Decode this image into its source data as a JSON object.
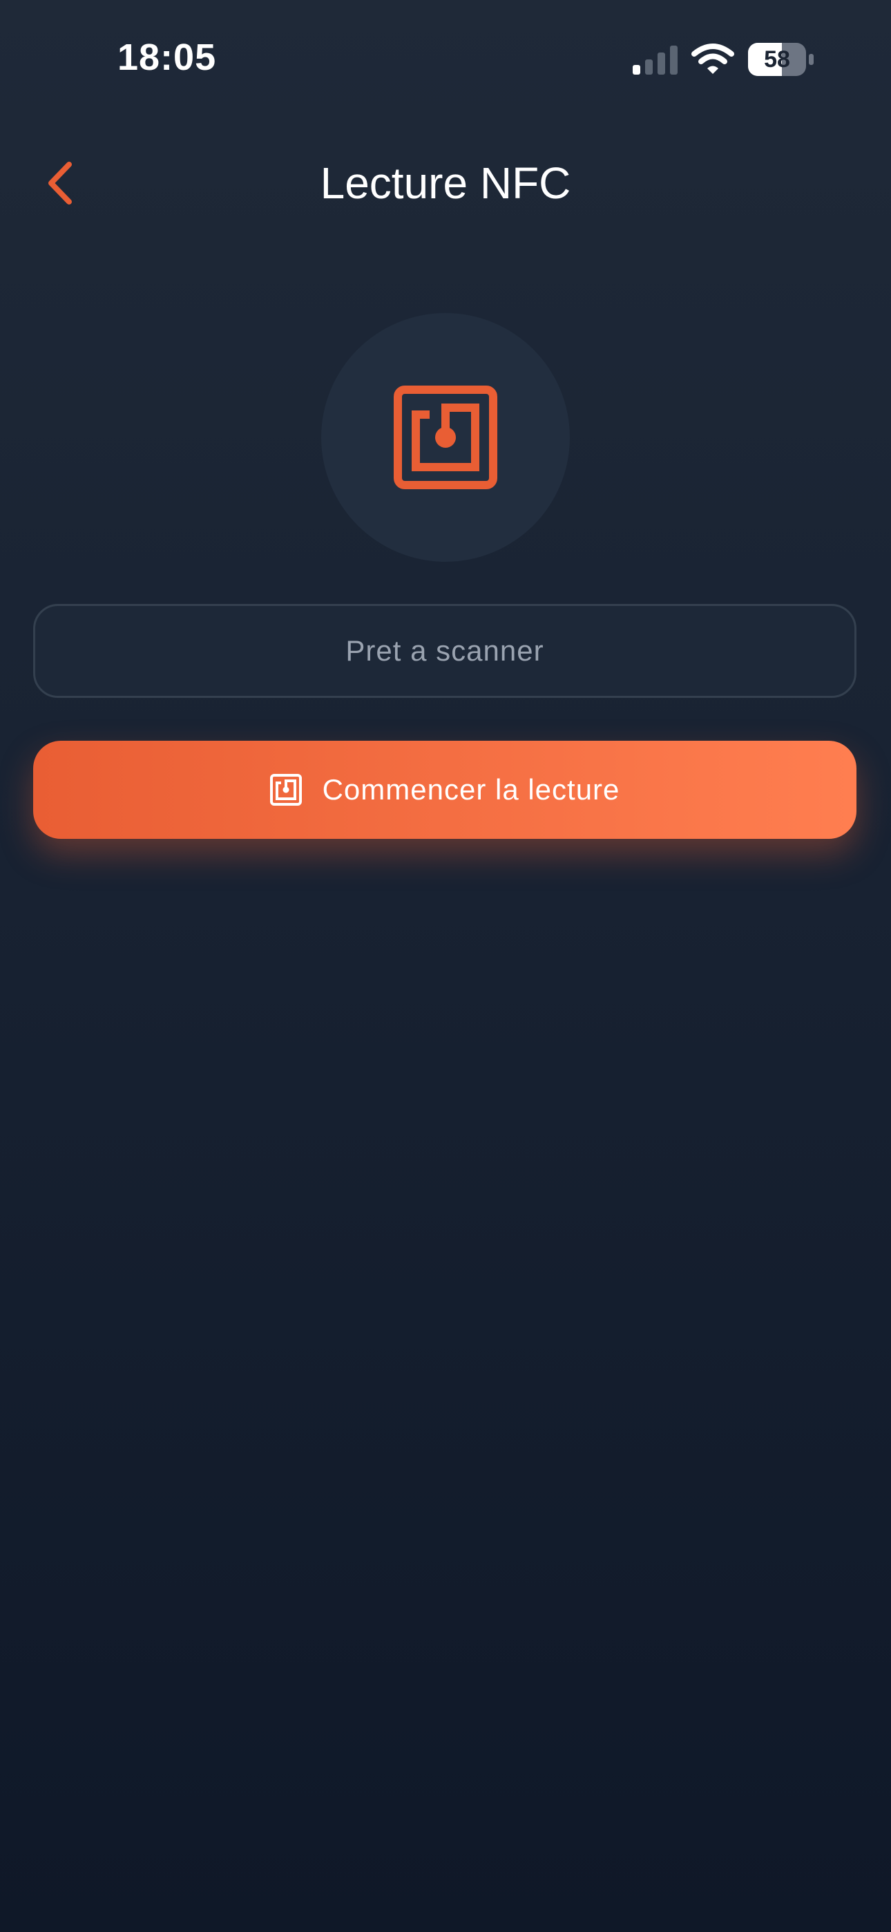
{
  "status_bar": {
    "time": "18:05",
    "battery_level": "58",
    "signal_bars_active": 1,
    "signal_bars_total": 4
  },
  "header": {
    "title": "Lecture NFC",
    "back_icon": "chevron-left-icon"
  },
  "nfc": {
    "icon": "nfc-tag-icon"
  },
  "status_field": {
    "text": "Pret a scanner"
  },
  "start_button": {
    "label": "Commencer la lecture",
    "icon": "nfc-tag-icon"
  },
  "colors": {
    "accent": "#e95e34",
    "accent_light": "#ff7e50",
    "background_top": "#1f2938",
    "background_bottom": "#0f1828",
    "circle": "#222e3f",
    "field_border": "#34404f",
    "muted_text": "#9aa3b0"
  }
}
